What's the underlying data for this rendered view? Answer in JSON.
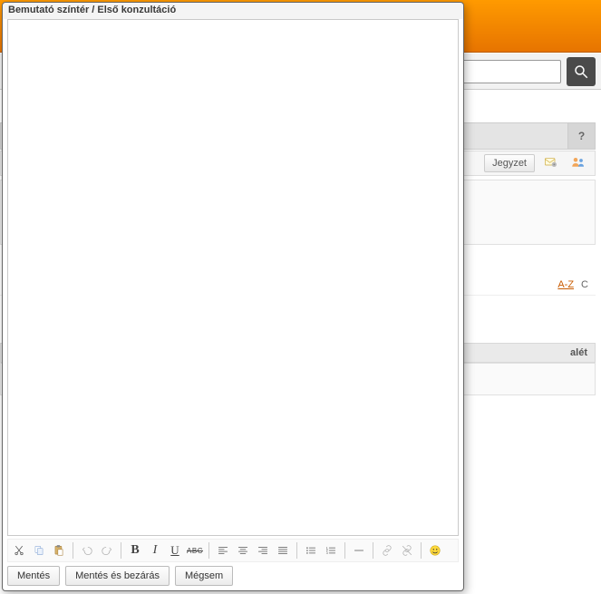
{
  "background": {
    "search": {
      "placeholder": ""
    },
    "help_label": "?",
    "jegyzet_label": "Jegyzet",
    "sort_az": "A-Z",
    "sort_c": "C",
    "section_title": "alét"
  },
  "modal": {
    "title": "Bemutató színtér / Első konzultáció",
    "footer": {
      "save": "Mentés",
      "save_close": "Mentés és bezárás",
      "cancel": "Mégsem"
    },
    "toolbar": {
      "cut": "cut",
      "copy": "copy",
      "paste": "paste",
      "undo": "undo",
      "redo": "redo",
      "bold": "B",
      "italic": "I",
      "underline": "U",
      "strike": "ABC",
      "align_left": "align-left",
      "align_center": "align-center",
      "align_right": "align-right",
      "align_justify": "align-justify",
      "bullet_list": "ul",
      "number_list": "ol",
      "hr": "hr",
      "link": "link",
      "unlink": "unlink",
      "smiley": "🙂"
    }
  }
}
